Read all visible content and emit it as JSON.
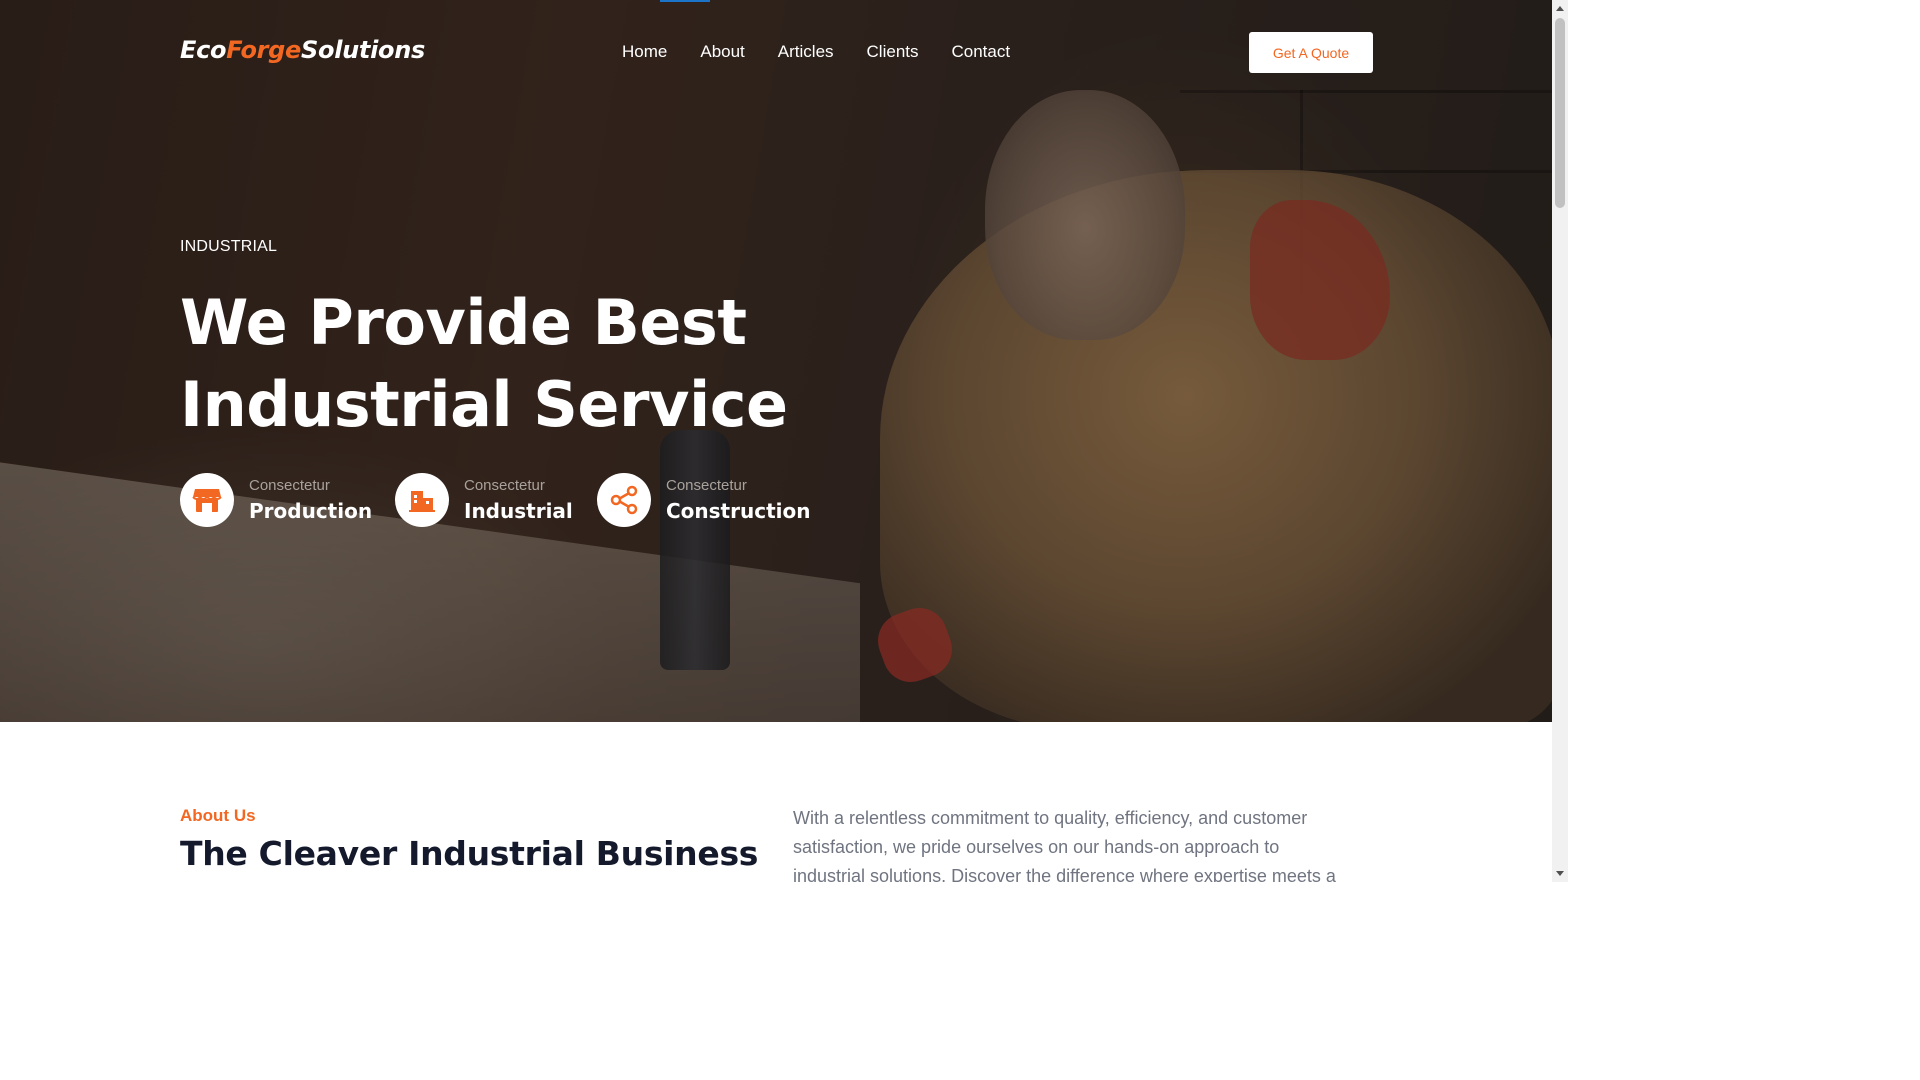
{
  "nav": {
    "logo": {
      "part1": "Eco",
      "part2": "Forge",
      "part3": "Solutions"
    },
    "links": [
      "Home",
      "About",
      "Articles",
      "Clients",
      "Contact"
    ],
    "cta": "Get A Quote"
  },
  "hero": {
    "eyebrow": "INDUSTRIAL",
    "headline_line1": "We Provide Best",
    "headline_line2": "Industrial Service",
    "features": [
      {
        "kicker": "Consectetur",
        "title": "Production",
        "icon": "storefront-icon"
      },
      {
        "kicker": "Consectetur",
        "title": "Industrial",
        "icon": "factory-icon"
      },
      {
        "kicker": "Consectetur",
        "title": "Construction",
        "icon": "share-icon"
      }
    ]
  },
  "about": {
    "tag": "About Us",
    "title": "The Cleaver Industrial Business",
    "text": "With a relentless commitment to quality, efficiency, and customer satisfaction, we pride ourselves on our hands-on approach to industrial solutions. Discover the difference where expertise meets a"
  },
  "colors": {
    "accent": "#f26722",
    "heading_dark": "#14192b",
    "body_text": "#6f7480"
  }
}
